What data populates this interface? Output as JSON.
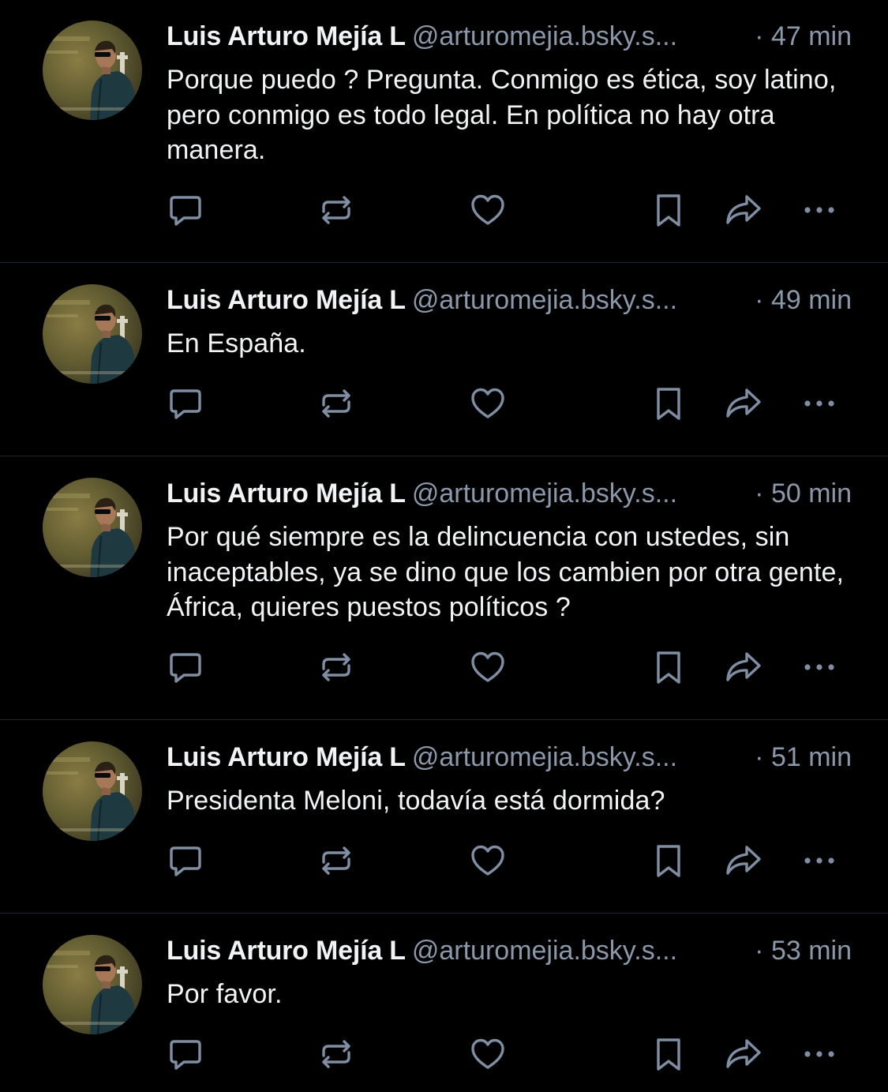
{
  "colors": {
    "background": "#000000",
    "text": "#f1f3f5",
    "muted": "#8b98a9",
    "icon": "#7f8ea3",
    "divider": "#1e2530"
  },
  "posts": [
    {
      "author": "Luis Arturo Mejía L",
      "handle": "@arturomejia.bsky.s...",
      "time": "· 47 min",
      "text": "Porque puedo ? Pregunta. Conmigo es ética, soy latino, pero conmigo es todo legal. En política no hay otra manera."
    },
    {
      "author": "Luis Arturo Mejía L",
      "handle": "@arturomejia.bsky.s...",
      "time": "· 49 min",
      "text": "En España."
    },
    {
      "author": "Luis Arturo Mejía L",
      "handle": "@arturomejia.bsky.s...",
      "time": "· 50 min",
      "text": "Por qué siempre es la delincuencia con ustedes, sin inaceptables, ya se dino que los cambien por otra gente, África, quieres puestos políticos ?"
    },
    {
      "author": "Luis Arturo Mejía L",
      "handle": "@arturomejia.bsky.s...",
      "time": "· 51 min",
      "text": "Presidenta Meloni, todavía está dormida?"
    },
    {
      "author": "Luis Arturo Mejía L",
      "handle": "@arturomejia.bsky.s...",
      "time": "· 53 min",
      "text": "Por favor."
    }
  ],
  "action_icons": [
    "reply-icon",
    "repost-icon",
    "like-icon",
    "bookmark-icon",
    "share-icon",
    "more-icon"
  ]
}
